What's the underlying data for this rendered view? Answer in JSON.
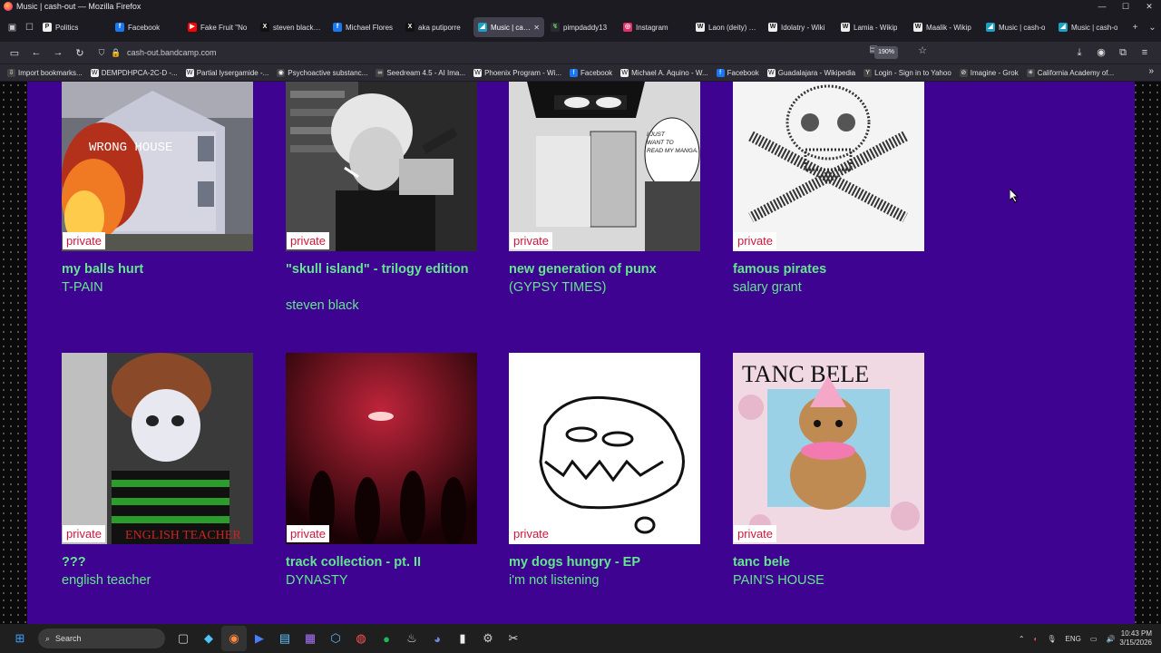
{
  "window": {
    "title": "Music | cash-out — Mozilla Firefox",
    "min": "—",
    "max": "☐",
    "close": "✕"
  },
  "tabs": [
    {
      "label": "Politics",
      "icon": "P",
      "color": "#f0f0f0",
      "fg": "#222"
    },
    {
      "label": "Facebook",
      "icon": "f",
      "color": "#1877f2",
      "fg": "#fff"
    },
    {
      "label": "Fake Fruit \"No",
      "icon": "▶",
      "color": "#ff0000",
      "fg": "#fff"
    },
    {
      "label": "steven black (@",
      "icon": "X",
      "color": "#111",
      "fg": "#fff"
    },
    {
      "label": "Michael Flores",
      "icon": "f",
      "color": "#1877f2",
      "fg": "#fff"
    },
    {
      "label": "aka putiporre",
      "icon": "X",
      "color": "#111",
      "fg": "#fff"
    },
    {
      "label": "Music | cash-o",
      "icon": "◢",
      "color": "#1da0c3",
      "fg": "#fff",
      "active": true
    },
    {
      "label": "pimpdaddy13",
      "icon": "↯",
      "color": "#2b2a33",
      "fg": "#5fd35f"
    },
    {
      "label": "Instagram",
      "icon": "◎",
      "color": "#e1306c",
      "fg": "#fff"
    },
    {
      "label": "Laon (deity) - W",
      "icon": "W",
      "color": "#eee",
      "fg": "#111"
    },
    {
      "label": "Idolatry - Wiki",
      "icon": "W",
      "color": "#eee",
      "fg": "#111"
    },
    {
      "label": "Lamia - Wikip",
      "icon": "W",
      "color": "#eee",
      "fg": "#111"
    },
    {
      "label": "Maalik - Wikip",
      "icon": "W",
      "color": "#eee",
      "fg": "#111"
    },
    {
      "label": "Music | cash-o",
      "icon": "◢",
      "color": "#1da0c3",
      "fg": "#fff"
    },
    {
      "label": "Music | cash-o",
      "icon": "◢",
      "color": "#1da0c3",
      "fg": "#fff"
    }
  ],
  "url": "cash-out.bandcamp.com",
  "zoom": "190%",
  "bookmarks": [
    {
      "label": "Import bookmarks...",
      "icon": "⇩"
    },
    {
      "label": "DEMPDHPCA-2C-D -...",
      "icon": "W"
    },
    {
      "label": "Partial lysergamide -...",
      "icon": "W"
    },
    {
      "label": "Psychoactive substanc...",
      "icon": "◉"
    },
    {
      "label": "Seedream 4.5 - AI Ima...",
      "icon": "∞"
    },
    {
      "label": "Phoenix Program - Wi...",
      "icon": "W"
    },
    {
      "label": "Facebook",
      "icon": "f"
    },
    {
      "label": "Michael A. Aquino - W...",
      "icon": "W"
    },
    {
      "label": "Facebook",
      "icon": "f"
    },
    {
      "label": "Guadalajara - Wikipedia",
      "icon": "W"
    },
    {
      "label": "Login - Sign in to Yahoo",
      "icon": "Y"
    },
    {
      "label": "Imagine - Grok",
      "icon": "⊘"
    },
    {
      "label": "California Academy of...",
      "icon": "✳"
    }
  ],
  "albums": [
    {
      "title": "my balls hurt",
      "artist": "T-PAIN",
      "badge": "private",
      "art_text": "WRONG HOUSE"
    },
    {
      "title": "\"skull island\" - trilogy edition",
      "artist": "steven black",
      "badge": "private",
      "art_text": ""
    },
    {
      "title": "new generation of punx",
      "artist": "(GYPSY TIMES)",
      "badge": "private",
      "art_text": "I JUST WANT TO READ MY MANGA."
    },
    {
      "title": "famous pirates",
      "artist": "salary grant",
      "badge": "private",
      "art_text": ""
    },
    {
      "title": "???",
      "artist": "english teacher",
      "badge": "private",
      "art_text": "ENGLISH TEACHER"
    },
    {
      "title": "track collection - pt. II",
      "artist": "DYNASTY",
      "badge": "private",
      "art_text": ""
    },
    {
      "title": "my dogs hungry - EP",
      "artist": "i'm not listening",
      "badge": "private",
      "art_text": ""
    },
    {
      "title": "tanc bele",
      "artist": "PAIN'S HOUSE",
      "badge": "private",
      "art_text": "TANC BELE"
    }
  ],
  "taskbar": {
    "search": "Search",
    "lang": "ENG",
    "time": "10:43 PM",
    "date": "3/15/2026"
  }
}
